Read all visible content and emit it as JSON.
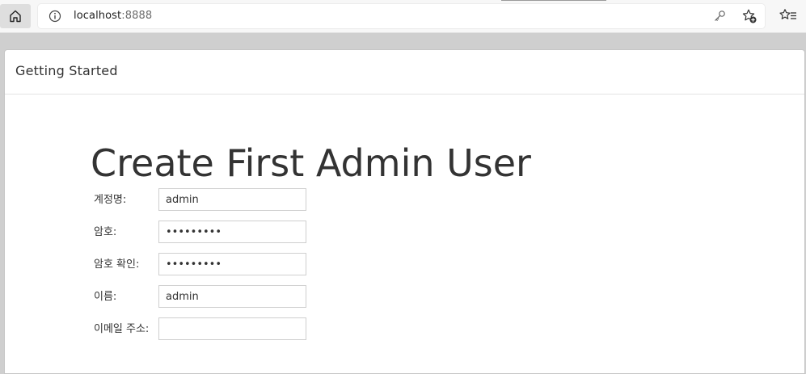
{
  "browser": {
    "url_host": "localhost",
    "url_port": ":8888",
    "icons": [
      "home-icon",
      "info-icon",
      "key-icon",
      "add-favorite-icon",
      "favorites-icon"
    ]
  },
  "page": {
    "header_title": "Getting Started",
    "heading": "Create First Admin User"
  },
  "form": {
    "username_label": "계정명:",
    "username_value": "admin",
    "password_label": "암호:",
    "password_value": "•••••••••",
    "confirm_label": "암호 확인:",
    "confirm_value": "•••••••••",
    "fullname_label": "이름:",
    "fullname_value": "admin",
    "email_label": "이메일 주소:",
    "email_value": ""
  }
}
